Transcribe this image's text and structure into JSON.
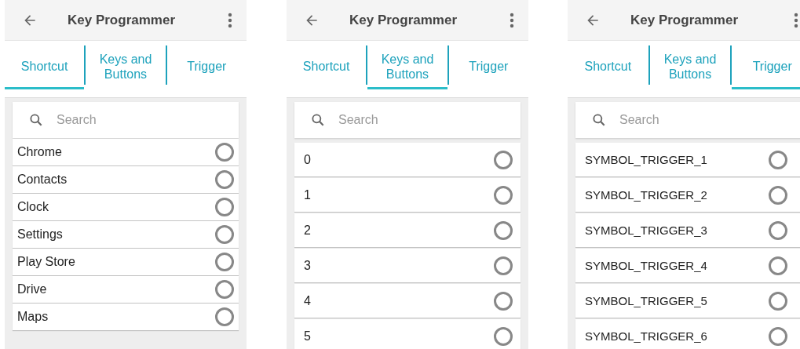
{
  "screens": [
    {
      "title": "Key Programmer",
      "tabs": [
        {
          "label": "Shortcut",
          "selected": true
        },
        {
          "label": "Keys and Buttons",
          "selected": false
        },
        {
          "label": "Trigger",
          "selected": false
        }
      ],
      "search": {
        "placeholder": "Search"
      },
      "items": [
        {
          "label": "Chrome",
          "selected": false
        },
        {
          "label": "Contacts",
          "selected": false
        },
        {
          "label": "Clock",
          "selected": false
        },
        {
          "label": "Settings",
          "selected": false
        },
        {
          "label": "Play Store",
          "selected": false
        },
        {
          "label": "Drive",
          "selected": false
        },
        {
          "label": "Maps",
          "selected": false
        }
      ]
    },
    {
      "title": "Key Programmer",
      "tabs": [
        {
          "label": "Shortcut",
          "selected": false
        },
        {
          "label": "Keys and Buttons",
          "selected": true
        },
        {
          "label": "Trigger",
          "selected": false
        }
      ],
      "search": {
        "placeholder": "Search"
      },
      "items": [
        {
          "label": "0",
          "selected": false
        },
        {
          "label": "1",
          "selected": false
        },
        {
          "label": "2",
          "selected": false
        },
        {
          "label": "3",
          "selected": false
        },
        {
          "label": "4",
          "selected": false
        },
        {
          "label": "5",
          "selected": false
        }
      ]
    },
    {
      "title": "Key Programmer",
      "tabs": [
        {
          "label": "Shortcut",
          "selected": false
        },
        {
          "label": "Keys and Buttons",
          "selected": false
        },
        {
          "label": "Trigger",
          "selected": true
        }
      ],
      "search": {
        "placeholder": "Search"
      },
      "items": [
        {
          "label": "SYMBOL_TRIGGER_1",
          "selected": false
        },
        {
          "label": "SYMBOL_TRIGGER_2",
          "selected": false
        },
        {
          "label": "SYMBOL_TRIGGER_3",
          "selected": false
        },
        {
          "label": "SYMBOL_TRIGGER_4",
          "selected": false
        },
        {
          "label": "SYMBOL_TRIGGER_5",
          "selected": false
        },
        {
          "label": "SYMBOL_TRIGGER_6",
          "selected": false
        }
      ]
    }
  ]
}
